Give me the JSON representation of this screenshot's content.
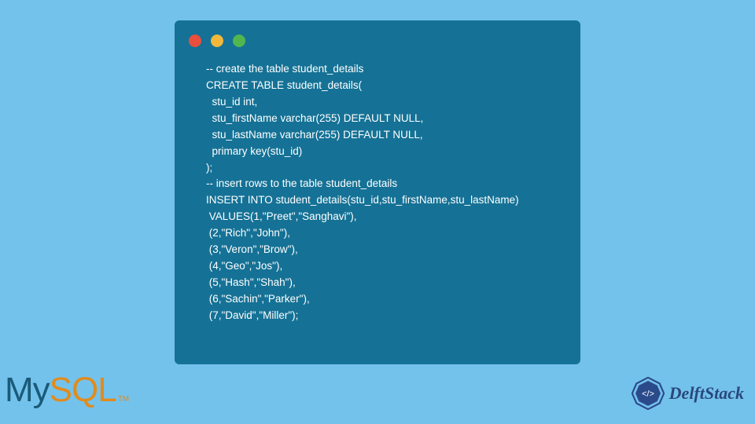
{
  "code": {
    "lines": [
      "-- create the table student_details",
      "CREATE TABLE student_details(",
      "  stu_id int,",
      "  stu_firstName varchar(255) DEFAULT NULL,",
      "  stu_lastName varchar(255) DEFAULT NULL,",
      "  primary key(stu_id)",
      ");",
      "-- insert rows to the table student_details",
      "INSERT INTO student_details(stu_id,stu_firstName,stu_lastName)",
      " VALUES(1,\"Preet\",\"Sanghavi\"),",
      " (2,\"Rich\",\"John\"),",
      " (3,\"Veron\",\"Brow\"),",
      " (4,\"Geo\",\"Jos\"),",
      " (5,\"Hash\",\"Shah\"),",
      " (6,\"Sachin\",\"Parker\"),",
      " (7,\"David\",\"Miller\");"
    ]
  },
  "logos": {
    "mysql_my": "My",
    "mysql_sql": "SQL",
    "mysql_tm": "TM",
    "delft_text": "DelftStack"
  }
}
